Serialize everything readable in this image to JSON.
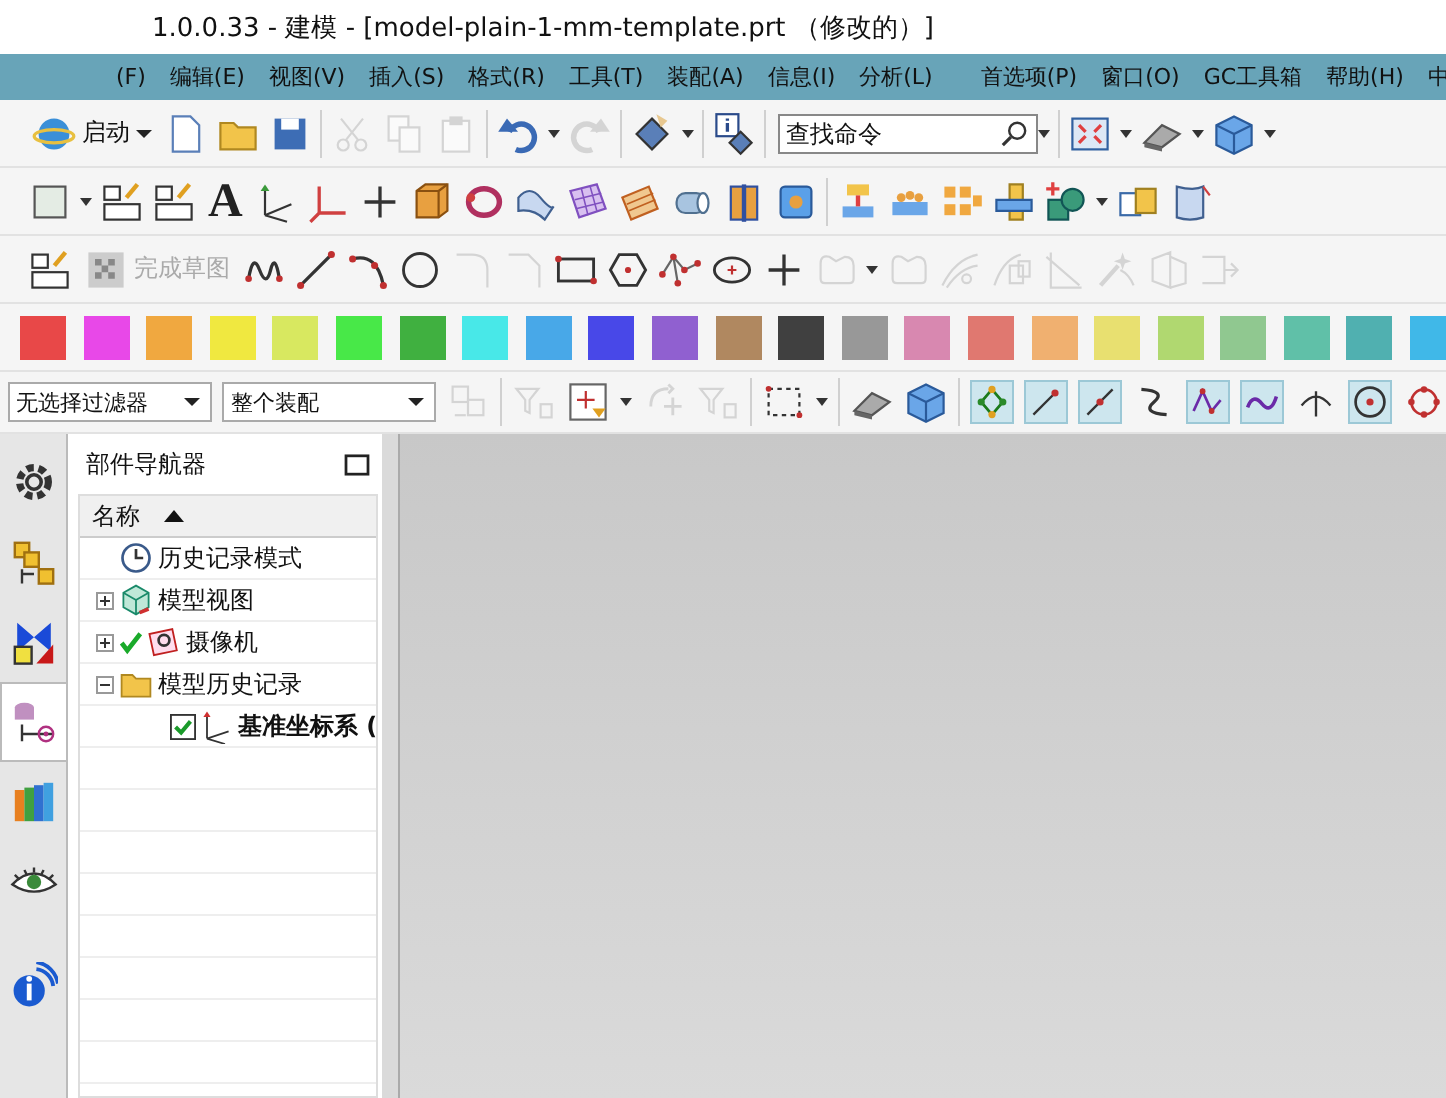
{
  "window": {
    "title": "1.0.0.33 - 建模 - [model-plain-1-mm-template.prt （修改的）]"
  },
  "menu": [
    "(F)",
    "编辑(E)",
    "视图(V)",
    "插入(S)",
    "格式(R)",
    "工具(T)",
    "装配(A)",
    "信息(I)",
    "分析(L)",
    "首选项(P)",
    "窗口(O)",
    "GC工具箱",
    "帮助(H)",
    "中"
  ],
  "standard_bar": {
    "start_label": "启动",
    "search": {
      "placeholder": "查找命令"
    },
    "items": [
      {
        "kind": "doc",
        "disabled": false
      },
      {
        "kind": "folder",
        "disabled": false
      },
      {
        "kind": "disk",
        "disabled": false
      },
      {
        "kind": "sep"
      },
      {
        "kind": "scissors",
        "disabled": true
      },
      {
        "kind": "copy",
        "disabled": true
      },
      {
        "kind": "paste",
        "disabled": true
      },
      {
        "kind": "sep"
      },
      {
        "kind": "undo",
        "disabled": false
      },
      {
        "kind": "caret"
      },
      {
        "kind": "redo",
        "disabled": true
      },
      {
        "kind": "sep"
      },
      {
        "kind": "diamond",
        "disabled": false
      },
      {
        "kind": "caret"
      },
      {
        "kind": "sep"
      },
      {
        "kind": "info",
        "disabled": false
      },
      {
        "kind": "sep"
      }
    ],
    "view_items": [
      {
        "kind": "fit",
        "disabled": false
      },
      {
        "kind": "caret"
      },
      {
        "kind": "render",
        "disabled": false
      },
      {
        "kind": "caret"
      },
      {
        "kind": "cube",
        "disabled": false
      },
      {
        "kind": "caret"
      }
    ]
  },
  "feature_bar": [
    {
      "kind": "sheet",
      "disabled": false
    },
    {
      "kind": "caret"
    },
    {
      "kind": "sketch",
      "disabled": false
    },
    {
      "kind": "sketch",
      "disabled": false
    },
    {
      "kind": "letter",
      "label": "A",
      "disabled": false
    },
    {
      "kind": "csys",
      "disabled": false
    },
    {
      "kind": "axes",
      "disabled": false
    },
    {
      "kind": "plus",
      "disabled": false
    },
    {
      "kind": "block",
      "disabled": false
    },
    {
      "kind": "revolve",
      "disabled": false
    },
    {
      "kind": "surface",
      "disabled": false
    },
    {
      "kind": "mesh",
      "disabled": false
    },
    {
      "kind": "wave",
      "disabled": false
    },
    {
      "kind": "tube",
      "disabled": false
    },
    {
      "kind": "split",
      "disabled": false
    },
    {
      "kind": "hole",
      "disabled": false
    },
    {
      "kind": "sep"
    },
    {
      "kind": "emboss",
      "disabled": false
    },
    {
      "kind": "pattern",
      "disabled": false
    },
    {
      "kind": "array",
      "disabled": false
    },
    {
      "kind": "intersect",
      "disabled": false
    },
    {
      "kind": "unite",
      "disabled": false
    },
    {
      "kind": "caret"
    },
    {
      "kind": "boxes",
      "disabled": false
    },
    {
      "kind": "trim",
      "disabled": false
    }
  ],
  "sketch_bar": {
    "finish_label": "完成草图",
    "finish_disabled": true,
    "items": [
      {
        "kind": "studio",
        "disabled": false
      },
      {
        "kind": "line",
        "disabled": false
      },
      {
        "kind": "arc",
        "disabled": false
      },
      {
        "kind": "circle",
        "disabled": false
      },
      {
        "kind": "fillet",
        "disabled": true
      },
      {
        "kind": "chamfer",
        "disabled": true
      },
      {
        "kind": "rect",
        "disabled": false
      },
      {
        "kind": "hex",
        "disabled": false
      },
      {
        "kind": "polyline",
        "disabled": false
      },
      {
        "kind": "ellipse",
        "disabled": false
      },
      {
        "kind": "plus",
        "disabled": false
      },
      {
        "kind": "profile",
        "disabled": true
      },
      {
        "kind": "caret"
      },
      {
        "kind": "profile",
        "disabled": true
      },
      {
        "kind": "offset",
        "disabled": true
      },
      {
        "kind": "curvepattern",
        "disabled": true
      },
      {
        "kind": "trimcurve",
        "disabled": true
      },
      {
        "kind": "wand",
        "disabled": true
      },
      {
        "kind": "mirror",
        "disabled": true
      },
      {
        "kind": "extend",
        "disabled": true
      }
    ]
  },
  "color_bar": [
    {
      "color": "#e84848"
    },
    {
      "color": "#e848e8"
    },
    {
      "color": "#f0a840"
    },
    {
      "color": "#f0e840"
    },
    {
      "color": "#d8e860"
    },
    {
      "color": "#48e848"
    },
    {
      "color": "#40b040"
    },
    {
      "color": "#48e8e8"
    },
    {
      "color": "#48a8e8"
    },
    {
      "color": "#4848e8"
    },
    {
      "color": "#9060d0"
    },
    {
      "color": "#b08860"
    },
    {
      "color": "#404040"
    },
    {
      "color": "#989898"
    },
    {
      "color": "#d888b0"
    },
    {
      "color": "#e07870"
    },
    {
      "color": "#f0b070"
    },
    {
      "color": "#e8e070"
    },
    {
      "color": "#b0d870"
    },
    {
      "color": "#90c890"
    },
    {
      "color": "#60c0a8"
    },
    {
      "color": "#50b0b0"
    },
    {
      "color": "#40b8e8"
    }
  ],
  "selection_bar": {
    "filter": "无选择过滤器",
    "scope": "整个装配",
    "tools": [
      {
        "kind": "assembly",
        "disabled": true
      },
      {
        "kind": "sep"
      },
      {
        "kind": "filter",
        "disabled": true
      },
      {
        "kind": "snapbox",
        "disabled": false
      },
      {
        "kind": "caret"
      },
      {
        "kind": "move",
        "disabled": true
      },
      {
        "kind": "filter",
        "disabled": true
      },
      {
        "kind": "sep"
      },
      {
        "kind": "marquee",
        "disabled": false
      },
      {
        "kind": "caret"
      },
      {
        "kind": "sep"
      },
      {
        "kind": "render",
        "disabled": false
      },
      {
        "kind": "cube",
        "disabled": false
      },
      {
        "kind": "sep"
      }
    ],
    "snaps": [
      {
        "kind": "snappoints",
        "on": true
      },
      {
        "kind": "endpoint",
        "on": true
      },
      {
        "kind": "midpoint",
        "on": true
      },
      {
        "kind": "curve",
        "on": false
      },
      {
        "kind": "controlpoint",
        "on": true
      },
      {
        "kind": "spline",
        "on": true
      },
      {
        "kind": "intersection",
        "on": false
      },
      {
        "kind": "center",
        "on": true
      },
      {
        "kind": "quadrant",
        "on": false
      }
    ]
  },
  "resource_tabs": [
    {
      "kind": "settings",
      "selected": false
    },
    {
      "kind": "assembly",
      "selected": false
    },
    {
      "kind": "constraints",
      "selected": false
    },
    {
      "kind": "part",
      "selected": true
    },
    {
      "kind": "library",
      "selected": false
    },
    {
      "kind": "eye",
      "selected": false
    },
    {
      "kind": "info",
      "selected": false
    }
  ],
  "navigator": {
    "title": "部件导航器",
    "column": "名称",
    "tree": [
      {
        "label": "历史记录模式",
        "kind": "clock"
      },
      {
        "label": "模型视图",
        "kind": "view",
        "expanded": false
      },
      {
        "label": "摄像机",
        "kind": "camera",
        "expanded": false,
        "checked": true
      },
      {
        "label": "模型历史记录",
        "kind": "folder",
        "expanded": true,
        "children": [
          {
            "label": "基准坐标系 (",
            "kind": "datum",
            "checked": true
          }
        ]
      }
    ]
  }
}
